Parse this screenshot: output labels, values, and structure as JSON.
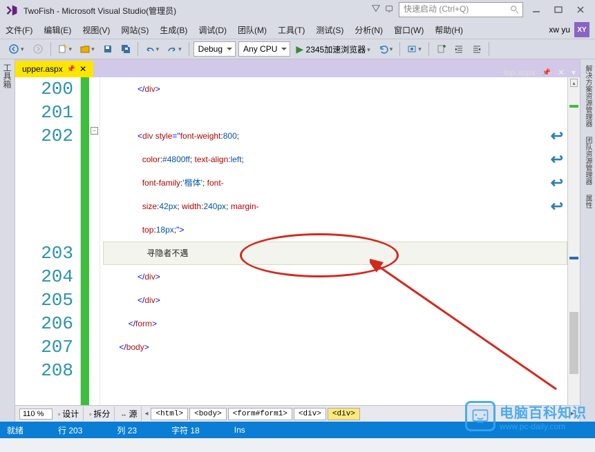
{
  "titlebar": {
    "title": "TwoFish - Microsoft Visual Studio(管理员)",
    "quick_launch_placeholder": "快速启动 (Ctrl+Q)"
  },
  "menubar": {
    "items": [
      "文件(F)",
      "编辑(E)",
      "视图(V)",
      "网站(S)",
      "生成(B)",
      "调试(D)",
      "团队(M)",
      "工具(T)",
      "测试(S)",
      "分析(N)",
      "窗口(W)",
      "帮助(H)"
    ],
    "user": "xw yu",
    "avatar": "XY"
  },
  "toolbar": {
    "config": "Debug",
    "platform": "Any CPU",
    "run_label": "2345加速浏览器"
  },
  "left_rail": {
    "label": "工具箱"
  },
  "right_rail": {
    "tabs": [
      "解决方案资源管理器",
      "团队资源管理器",
      "属性"
    ]
  },
  "tabs": {
    "active": {
      "name": "upper.aspx",
      "pinned": true
    },
    "inactive": {
      "name": "top.aspx"
    }
  },
  "code": {
    "line_numbers": [
      "200",
      "201",
      "202",
      "",
      "",
      "",
      "",
      "203",
      "204",
      "205",
      "206",
      "207",
      "208"
    ],
    "lines": [
      {
        "indent": "               ",
        "tokens": [
          {
            "t": "</",
            "c": "punct"
          },
          {
            "t": "div",
            "c": "tag"
          },
          {
            "t": ">",
            "c": "punct"
          }
        ]
      },
      {
        "indent": "",
        "tokens": []
      },
      {
        "indent": "               ",
        "wrap": true,
        "tokens": [
          {
            "t": "<",
            "c": "punct"
          },
          {
            "t": "div",
            "c": "tag"
          },
          {
            "t": " ",
            "c": "plain"
          },
          {
            "t": "style",
            "c": "attr"
          },
          {
            "t": "=\"",
            "c": "punct"
          },
          {
            "t": "font-weight",
            "c": "attr"
          },
          {
            "t": ":",
            "c": "plain"
          },
          {
            "t": "800",
            "c": "val"
          },
          {
            "t": "; ",
            "c": "plain"
          }
        ]
      },
      {
        "indent": "                 ",
        "wrap": true,
        "tokens": [
          {
            "t": "color",
            "c": "attr"
          },
          {
            "t": ":",
            "c": "plain"
          },
          {
            "t": "#4800ff",
            "c": "val"
          },
          {
            "t": "; ",
            "c": "plain"
          },
          {
            "t": "text-align",
            "c": "attr"
          },
          {
            "t": ":",
            "c": "plain"
          },
          {
            "t": "left",
            "c": "val"
          },
          {
            "t": ";",
            "c": "plain"
          }
        ]
      },
      {
        "indent": "                 ",
        "wrap": true,
        "tokens": [
          {
            "t": "font-family",
            "c": "attr"
          },
          {
            "t": ":",
            "c": "plain"
          },
          {
            "t": "'楷体'",
            "c": "val"
          },
          {
            "t": "; ",
            "c": "plain"
          },
          {
            "t": "font-",
            "c": "attr"
          }
        ]
      },
      {
        "indent": "                 ",
        "wrap": true,
        "tokens": [
          {
            "t": "size",
            "c": "attr"
          },
          {
            "t": ":",
            "c": "plain"
          },
          {
            "t": "42px",
            "c": "val"
          },
          {
            "t": "; ",
            "c": "plain"
          },
          {
            "t": "width",
            "c": "attr"
          },
          {
            "t": ":",
            "c": "plain"
          },
          {
            "t": "240px",
            "c": "val"
          },
          {
            "t": "; ",
            "c": "plain"
          },
          {
            "t": "margin-",
            "c": "attr"
          }
        ]
      },
      {
        "indent": "                 ",
        "tokens": [
          {
            "t": "top",
            "c": "attr"
          },
          {
            "t": ":",
            "c": "plain"
          },
          {
            "t": "18px",
            "c": "val"
          },
          {
            "t": ";",
            "c": "plain"
          },
          {
            "t": "\"",
            "c": "punct"
          },
          {
            "t": ">",
            "c": "punct"
          }
        ]
      },
      {
        "indent": "                   ",
        "hl": true,
        "tokens": [
          {
            "t": "寻隐者不遇",
            "c": "plain"
          }
        ]
      },
      {
        "indent": "               ",
        "tokens": [
          {
            "t": "</",
            "c": "punct"
          },
          {
            "t": "div",
            "c": "tag"
          },
          {
            "t": ">",
            "c": "punct"
          }
        ]
      },
      {
        "indent": "               ",
        "tokens": [
          {
            "t": "</",
            "c": "punct"
          },
          {
            "t": "div",
            "c": "tag"
          },
          {
            "t": ">",
            "c": "punct"
          }
        ]
      },
      {
        "indent": "           ",
        "tokens": [
          {
            "t": "</",
            "c": "punct"
          },
          {
            "t": "form",
            "c": "tag"
          },
          {
            "t": ">",
            "c": "punct"
          }
        ]
      },
      {
        "indent": "       ",
        "tokens": [
          {
            "t": "</",
            "c": "punct"
          },
          {
            "t": "body",
            "c": "tag"
          },
          {
            "t": ">",
            "c": "punct"
          }
        ]
      },
      {
        "indent": "",
        "tokens": []
      }
    ]
  },
  "bottom": {
    "zoom": "110 %",
    "design": "设计",
    "split": "拆分",
    "source": "源",
    "breadcrumb": [
      "<html>",
      "<body>",
      "<form#form1>",
      "<div>",
      "<div>"
    ]
  },
  "status": {
    "ready": "就绪",
    "line": "行 203",
    "col": "列 23",
    "char": "字符 18",
    "ins": "Ins"
  },
  "watermark": {
    "line1": "电脑百科知识",
    "line2": "www.pc-daily.com"
  }
}
